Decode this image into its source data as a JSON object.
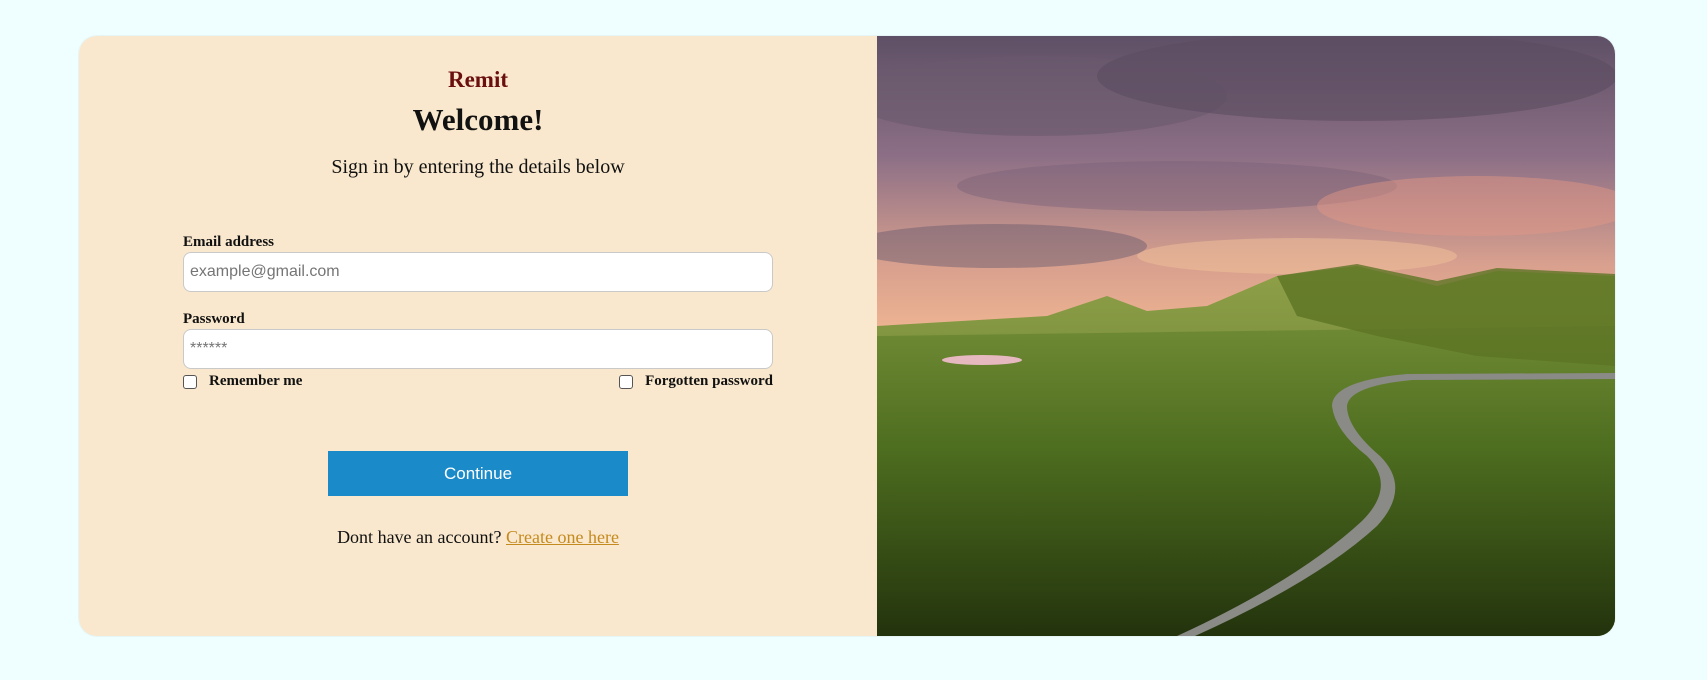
{
  "brand": "Remit",
  "heading": "Welcome!",
  "subtitle": "Sign in by entering the details below",
  "email": {
    "label": "Email address",
    "placeholder": "example@gmail.com",
    "value": ""
  },
  "password": {
    "label": "Password",
    "placeholder": "******",
    "value": ""
  },
  "remember_label": "Remember me",
  "forgot_label": "Forgotten password",
  "continue_label": "Continue",
  "signup": {
    "prompt": "Dont have an account? ",
    "link_text": "Create one here"
  },
  "colors": {
    "page_background": "#effefe",
    "panel_background": "#f9e8cd",
    "brand": "#6a0e0e",
    "button": "#1b8ac9",
    "link": "#c58a1e"
  },
  "hero_image": "landscape-photo"
}
